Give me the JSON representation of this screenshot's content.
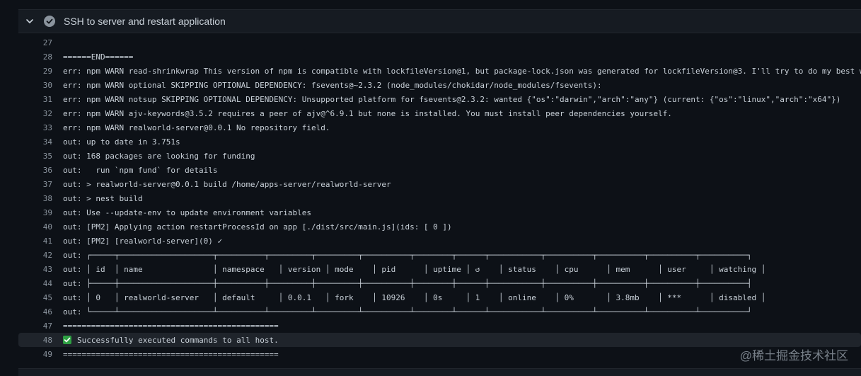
{
  "step": {
    "title": "SSH to server and restart application",
    "status": "success"
  },
  "log_lines": [
    {
      "n": "27",
      "t": ""
    },
    {
      "n": "28",
      "t": "======END======"
    },
    {
      "n": "29",
      "t": "err: npm WARN read-shrinkwrap This version of npm is compatible with lockfileVersion@1, but package-lock.json was generated for lockfileVersion@3. I'll try to do my best w"
    },
    {
      "n": "30",
      "t": "err: npm WARN optional SKIPPING OPTIONAL DEPENDENCY: fsevents@~2.3.2 (node_modules/chokidar/node_modules/fsevents):"
    },
    {
      "n": "31",
      "t": "err: npm WARN notsup SKIPPING OPTIONAL DEPENDENCY: Unsupported platform for fsevents@2.3.2: wanted {\"os\":\"darwin\",\"arch\":\"any\"} (current: {\"os\":\"linux\",\"arch\":\"x64\"})"
    },
    {
      "n": "32",
      "t": "err: npm WARN ajv-keywords@3.5.2 requires a peer of ajv@^6.9.1 but none is installed. You must install peer dependencies yourself."
    },
    {
      "n": "33",
      "t": "err: npm WARN realworld-server@0.0.1 No repository field."
    },
    {
      "n": "34",
      "t": "out: up to date in 3.751s"
    },
    {
      "n": "35",
      "t": "out: 168 packages are looking for funding"
    },
    {
      "n": "36",
      "t": "out:   run `npm fund` for details"
    },
    {
      "n": "37",
      "t": "out: > realworld-server@0.0.1 build /home/apps-server/realworld-server"
    },
    {
      "n": "38",
      "t": "out: > nest build"
    },
    {
      "n": "39",
      "t": "out: Use --update-env to update environment variables"
    },
    {
      "n": "40",
      "t": "out: [PM2] Applying action restartProcessId on app [./dist/src/main.js](ids: [ 0 ])"
    },
    {
      "n": "41",
      "t": "out: [PM2] [realworld-server](0) ✓"
    },
    {
      "n": "42",
      "t": "out: ┌─────┬────────────────────┬──────────┬─────────┬─────────┬──────────┬────────┬──────┬───────────┬──────────┬──────────┬──────────┬──────────┐"
    },
    {
      "n": "43",
      "t": "out: │ id  │ name               │ namespace   │ version │ mode    │ pid      │ uptime │ ↺    │ status    │ cpu      │ mem      │ user     │ watching │"
    },
    {
      "n": "44",
      "t": "out: ├─────┼────────────────────┼──────────┼─────────┼─────────┼──────────┼────────┼──────┼───────────┼──────────┼──────────┼──────────┼──────────┤"
    },
    {
      "n": "45",
      "t": "out: │ 0   │ realworld-server   │ default     │ 0.0.1   │ fork    │ 10926    │ 0s     │ 1    │ online    │ 0%       │ 3.8mb    │ ***      │ disabled │"
    },
    {
      "n": "46",
      "t": "out: └─────┴────────────────────┴──────────┴─────────┴─────────┴──────────┴────────┴──────┴───────────┴──────────┴──────────┴──────────┴──────────┘"
    },
    {
      "n": "47",
      "t": "=============================================="
    },
    {
      "n": "48",
      "t": "Successfully executed commands to all host.",
      "check": true
    },
    {
      "n": "49",
      "t": "=============================================="
    }
  ],
  "watermark": "@稀土掘金技术社区",
  "colors": {
    "success": "#2ea043",
    "background": "#0d1117",
    "header": "#161b22"
  },
  "icons": {
    "collapse": "chevron-down-icon",
    "status": "check-circle-icon",
    "emoji": "white-check-mark-icon"
  }
}
